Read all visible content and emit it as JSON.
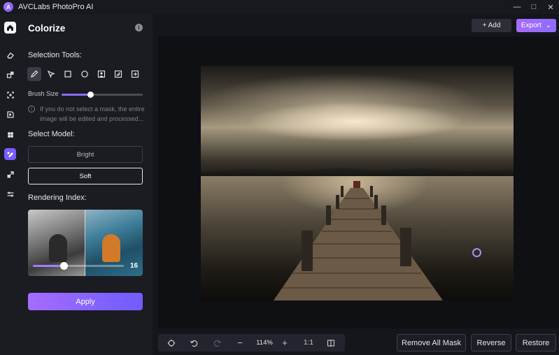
{
  "window": {
    "app_title": "AVCLabs PhotoPro AI",
    "logo_letter": "A",
    "controls": [
      "—",
      "□",
      "✕"
    ]
  },
  "rail": {
    "items": [
      "home-icon",
      "eraser-icon",
      "replace-icon",
      "upscale-icon",
      "portrait-icon",
      "remove-bg-icon",
      "colorize-icon",
      "expand-icon",
      "adjust-icon"
    ],
    "active": "colorize-icon"
  },
  "panel": {
    "title": "Colorize",
    "info": "i",
    "selection_tools_label": "Selection Tools:",
    "tools": [
      "brush-tool",
      "pointer-tool",
      "rect-tool",
      "ellipse-tool",
      "portrait-tool",
      "object-tool",
      "import-mask-tool"
    ],
    "brush_size_label": "Brush Size",
    "brush_size_value": 0.35,
    "hint_icon": "i",
    "hint_text": "If you do not select a mask, the entire image will be edited and processed...",
    "select_model_label": "Select Model:",
    "models": [
      {
        "label": "Bright",
        "selected": false
      },
      {
        "label": "Soft",
        "selected": true
      }
    ],
    "rendering_index_label": "Rendering Index:",
    "rendering_index_value": "16",
    "rendering_index_fraction": 0.34,
    "apply_label": "Apply"
  },
  "workspace": {
    "add_label": "+ Add",
    "export_label": "Export",
    "export_chevron": "⌄",
    "zoom_value": "114%",
    "ratio_label": "1:1",
    "zoom_out": "−",
    "zoom_in": "+",
    "remove_all_mask_label": "Remove All Mask",
    "reverse_label": "Reverse",
    "restore_label": "Restore"
  }
}
